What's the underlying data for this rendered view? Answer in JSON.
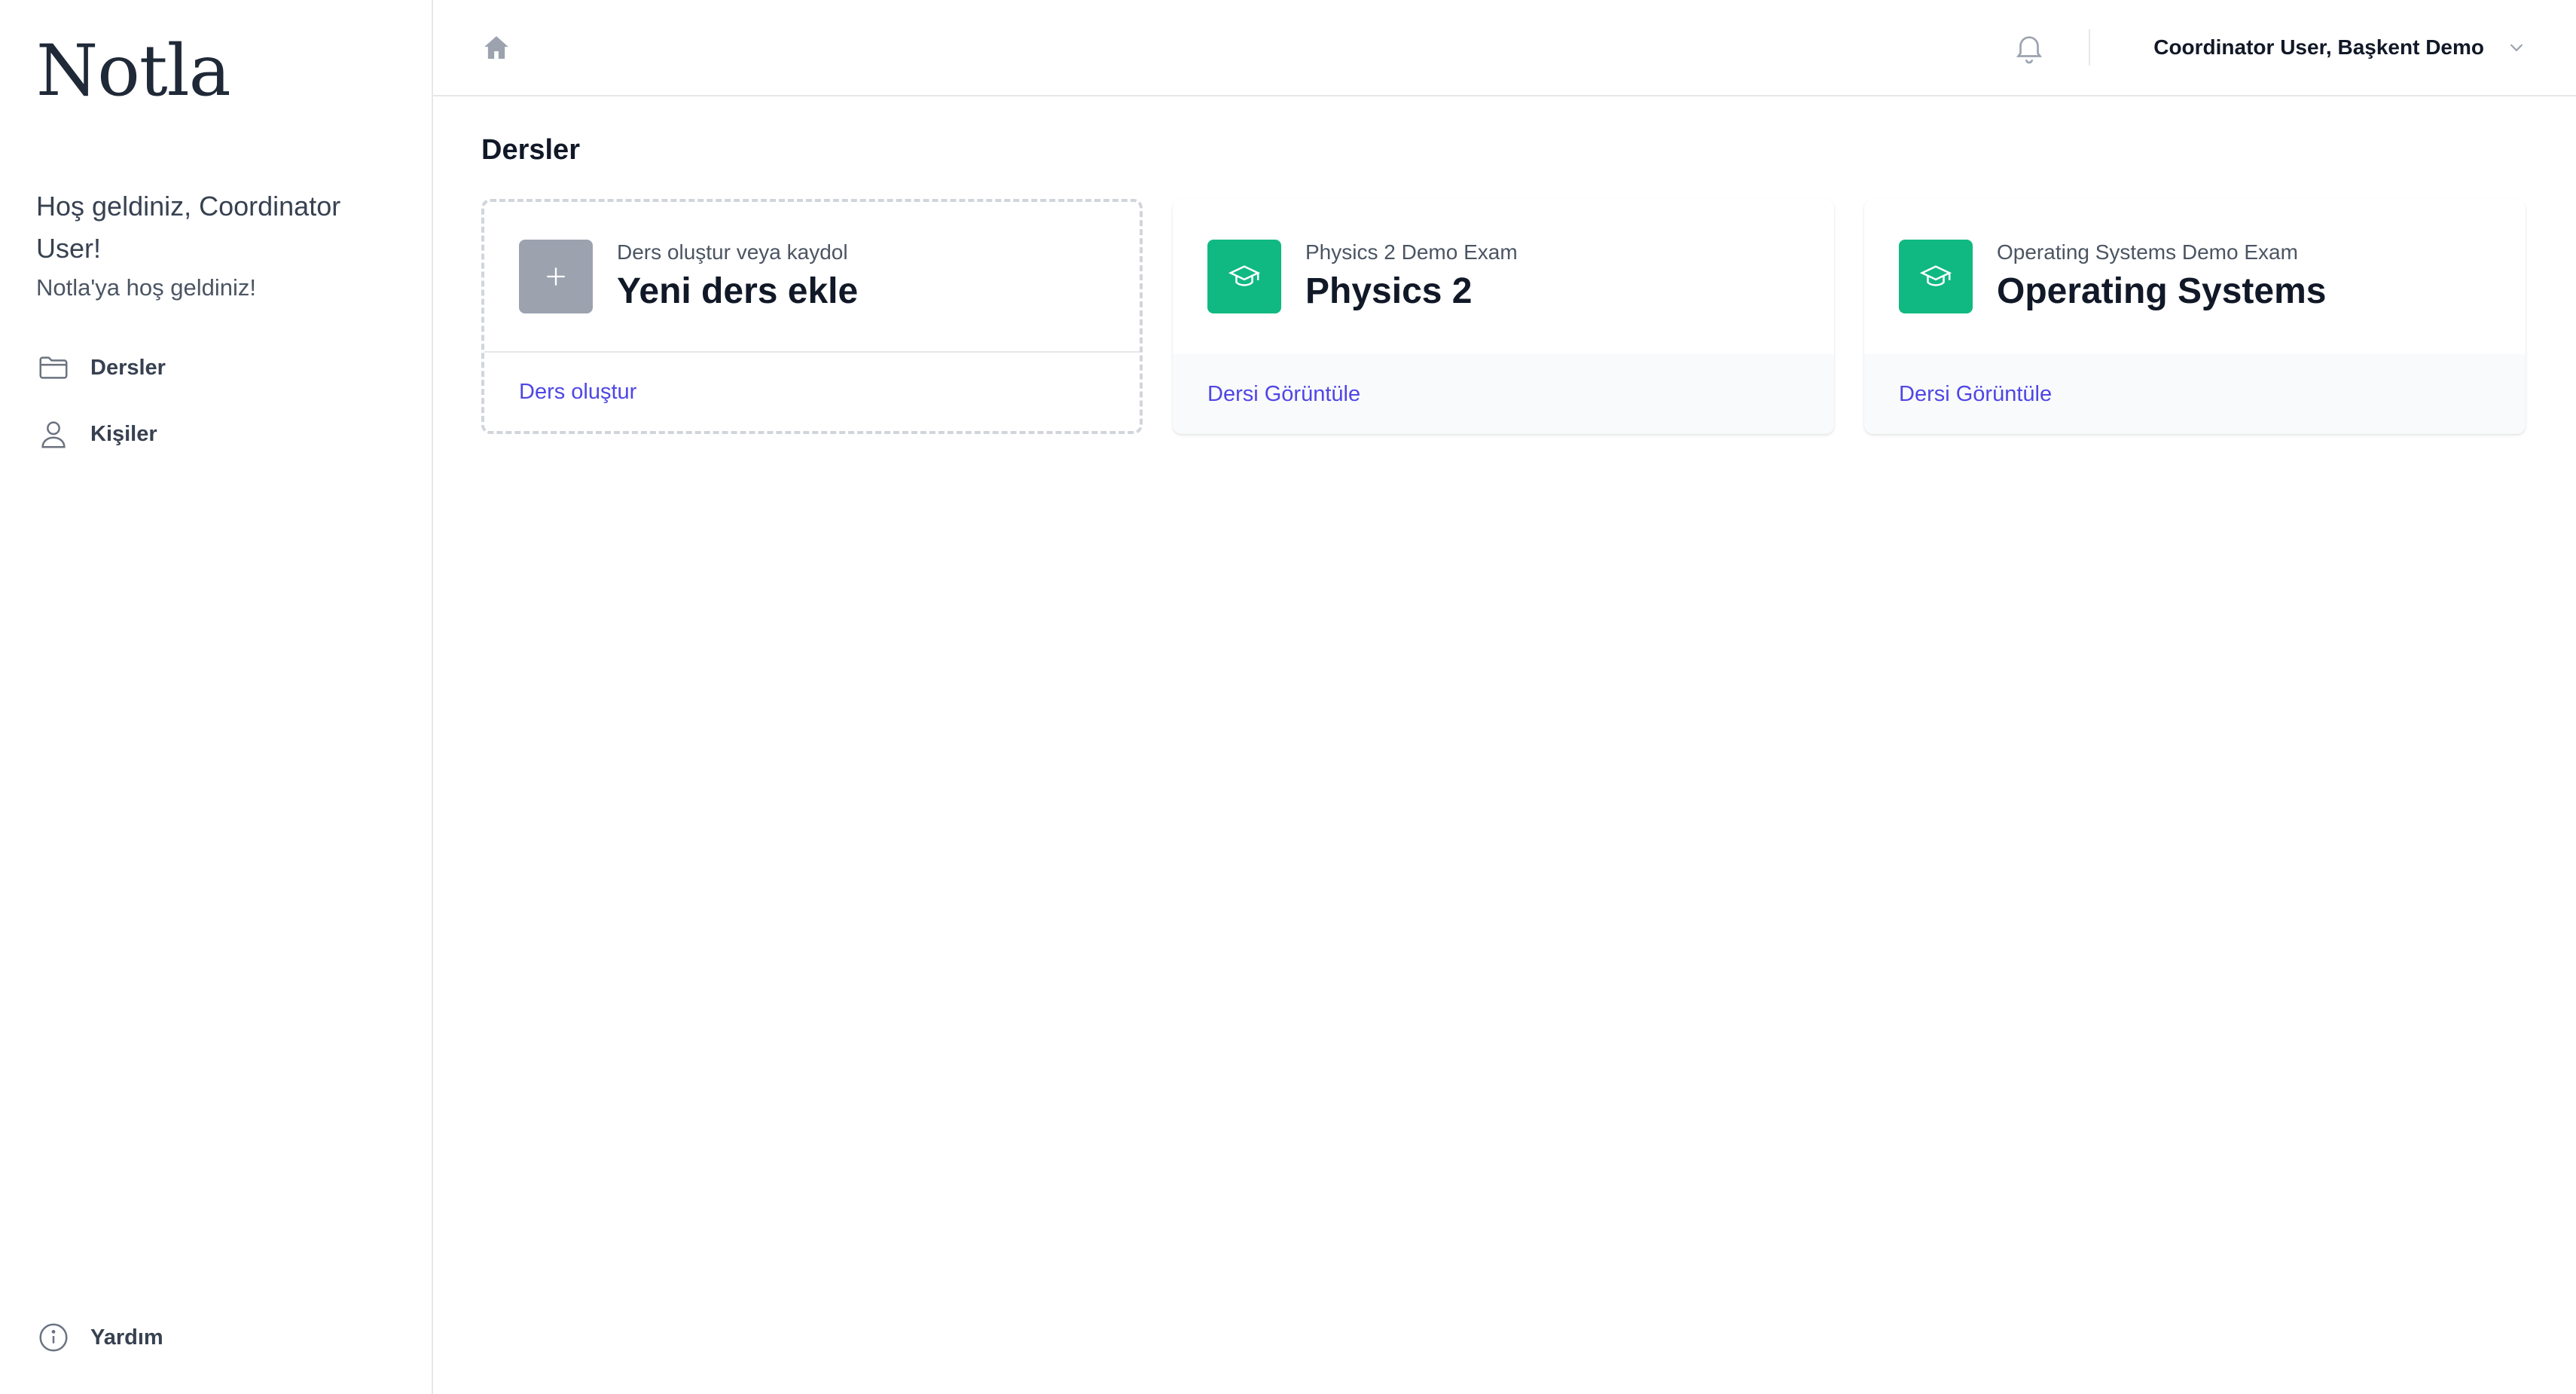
{
  "app": {
    "logo": "Notla"
  },
  "sidebar": {
    "welcome_title": "Hoş geldiniz, Coordinator User!",
    "welcome_sub": "Notla'ya hoş geldiniz!",
    "items": [
      {
        "label": "Dersler",
        "icon": "folder-icon"
      },
      {
        "label": "Kişiler",
        "icon": "user-icon"
      }
    ],
    "help_label": "Yardım"
  },
  "header": {
    "user": "Coordinator User, Başkent Demo"
  },
  "main": {
    "title": "Dersler",
    "add_card": {
      "subtitle": "Ders oluştur veya kaydol",
      "title": "Yeni ders ekle",
      "link": "Ders oluştur"
    },
    "courses": [
      {
        "subtitle": "Physics 2 Demo Exam",
        "title": "Physics 2",
        "link": "Dersi Görüntüle"
      },
      {
        "subtitle": "Operating Systems Demo Exam",
        "title": "Operating Systems",
        "link": "Dersi Görüntüle"
      }
    ]
  },
  "colors": {
    "accent": "#4f46e5",
    "course_tile": "#10b981",
    "add_tile": "#9ca3af"
  }
}
